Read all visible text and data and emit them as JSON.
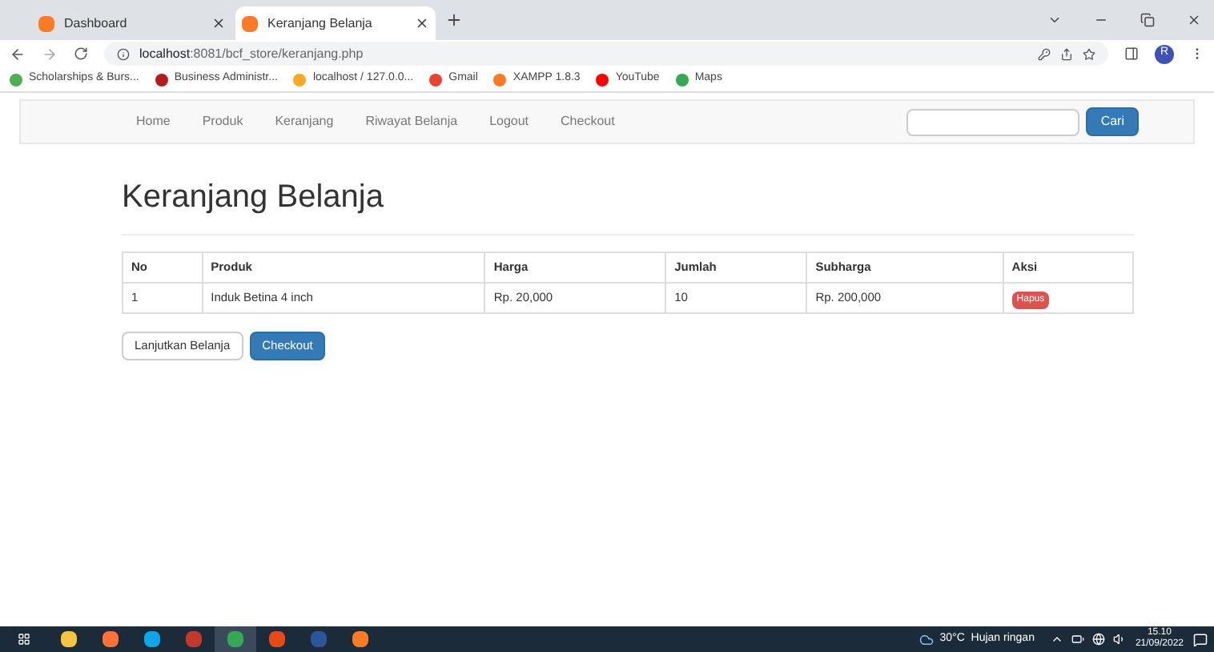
{
  "browser": {
    "tabs": [
      {
        "title": "Dashboard",
        "selected": false
      },
      {
        "title": "Keranjang Belanja",
        "selected": true
      }
    ],
    "address": {
      "host": "localhost",
      "rest": ":8081/bcf_store/keranjang.php"
    },
    "profile": "R",
    "bookmarks": [
      {
        "label": "Scholarships & Burs...",
        "color": "#4caf50"
      },
      {
        "label": "Business Administr...",
        "color": "#b71c1c"
      },
      {
        "label": "localhost / 127.0.0...",
        "color": "#f9a825"
      },
      {
        "label": "Gmail",
        "color": "#ea4335"
      },
      {
        "label": "XAMPP 1.8.3",
        "color": "#fb7a24"
      },
      {
        "label": "YouTube",
        "color": "#ff0000"
      },
      {
        "label": "Maps",
        "color": "#34a853"
      }
    ]
  },
  "navbar": {
    "items": [
      "Home",
      "Produk",
      "Keranjang",
      "Riwayat Belanja",
      "Logout",
      "Checkout"
    ],
    "search_button": "Cari"
  },
  "page": {
    "heading": "Keranjang Belanja",
    "table": {
      "columns": [
        "No",
        "Produk",
        "Harga",
        "Jumlah",
        "Subharga",
        "Aksi"
      ],
      "rows": [
        {
          "cells": [
            "1",
            "Induk Betina 4 inch",
            "Rp. 20,000",
            "10",
            "Rp. 200,000"
          ],
          "action": "Hapus"
        }
      ]
    },
    "buttons": [
      {
        "label": "Lanjutkan Belanja",
        "kind": "default"
      },
      {
        "label": "Checkout",
        "kind": "primary"
      }
    ]
  },
  "taskbar": {
    "apps": [
      {
        "selected": false
      },
      {
        "selected": false
      },
      {
        "selected": false
      },
      {
        "selected": false
      },
      {
        "selected": true
      },
      {
        "selected": false
      },
      {
        "selected": false
      },
      {
        "selected": false
      }
    ],
    "weather": "30°C  Hujan ringan",
    "time": "15.10",
    "date": "21/09/2022"
  }
}
